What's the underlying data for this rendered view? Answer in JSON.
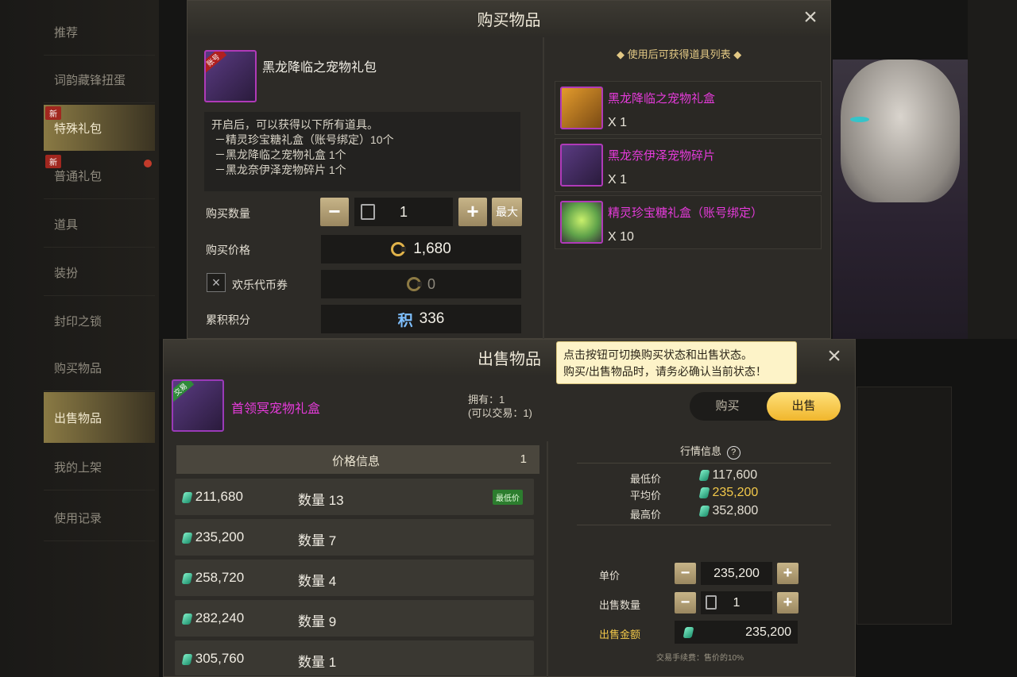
{
  "top_sidebar": {
    "items": [
      {
        "label": "推荐"
      },
      {
        "label": "词韵藏锋扭蛋"
      },
      {
        "label": "特殊礼包",
        "badge": "新"
      },
      {
        "label": "普通礼包",
        "badge": "新"
      },
      {
        "label": "道具"
      },
      {
        "label": "装扮"
      },
      {
        "label": "封印之锁"
      }
    ]
  },
  "buy_dialog": {
    "title": "购买物品",
    "item_name": "黑龙降临之宠物礼包",
    "item_tag": "账号",
    "description": [
      "开启后，可以获得以下所有道具。",
      "－精灵珍宝糖礼盒（账号绑定）10个",
      "－黑龙降临之宠物礼盒 1个",
      "－黑龙奈伊泽宠物碎片 1个"
    ],
    "quantity_label": "购买数量",
    "quantity": "1",
    "max_label": "最大",
    "price_label": "购买价格",
    "price": "1,680",
    "voucher_label": "欢乐代币券",
    "voucher_value": "0",
    "points_label": "累积积分",
    "points_icon": "积",
    "points_value": "336",
    "rewards_title": "◆ 使用后可获得道具列表 ◆",
    "rewards": [
      {
        "name": "黑龙降临之宠物礼盒",
        "qty": "X 1"
      },
      {
        "name": "黑龙奈伊泽宠物碎片",
        "qty": "X 1"
      },
      {
        "name": "精灵珍宝糖礼盒（账号绑定）",
        "qty": "X 10"
      }
    ]
  },
  "bottom_sidebar": {
    "items": [
      {
        "label": "购买物品"
      },
      {
        "label": "出售物品"
      },
      {
        "label": "我的上架"
      },
      {
        "label": "使用记录"
      }
    ]
  },
  "sell_dialog": {
    "title": "出售物品",
    "tooltip_line1": "点击按钮可切换购买状态和出售状态。",
    "tooltip_line2": "购买/出售物品时，请务必确认当前状态！",
    "item_name": "首领冥宠物礼盒",
    "item_tag": "交易",
    "owned": "拥有：1",
    "tradable": "(可以交易：1)",
    "toggle_buy": "购买",
    "toggle_sell": "出售",
    "price_info_label": "价格信息",
    "price_info_page": "1",
    "listings": [
      {
        "price": "211,680",
        "qty": "数量 13",
        "badge": "最低价"
      },
      {
        "price": "235,200",
        "qty": "数量 7"
      },
      {
        "price": "258,720",
        "qty": "数量 4"
      },
      {
        "price": "282,240",
        "qty": "数量 9"
      },
      {
        "price": "305,760",
        "qty": "数量 1"
      }
    ],
    "market_title": "行情信息",
    "market": {
      "min_label": "最低价",
      "min": "117,600",
      "avg_label": "平均价",
      "avg": "235,200",
      "max_label": "最高价",
      "max": "352,800"
    },
    "unit_price_label": "单价",
    "unit_price": "235,200",
    "sell_qty_label": "出售数量",
    "sell_qty": "1",
    "sell_amount_label": "出售金额",
    "sell_amount": "235,200",
    "fee_note": "交易手续费：售价的10%"
  },
  "colors": {
    "accent_gold": "#f3c94a",
    "item_magenta": "#e63bdb",
    "panel": "#2d2b27"
  }
}
